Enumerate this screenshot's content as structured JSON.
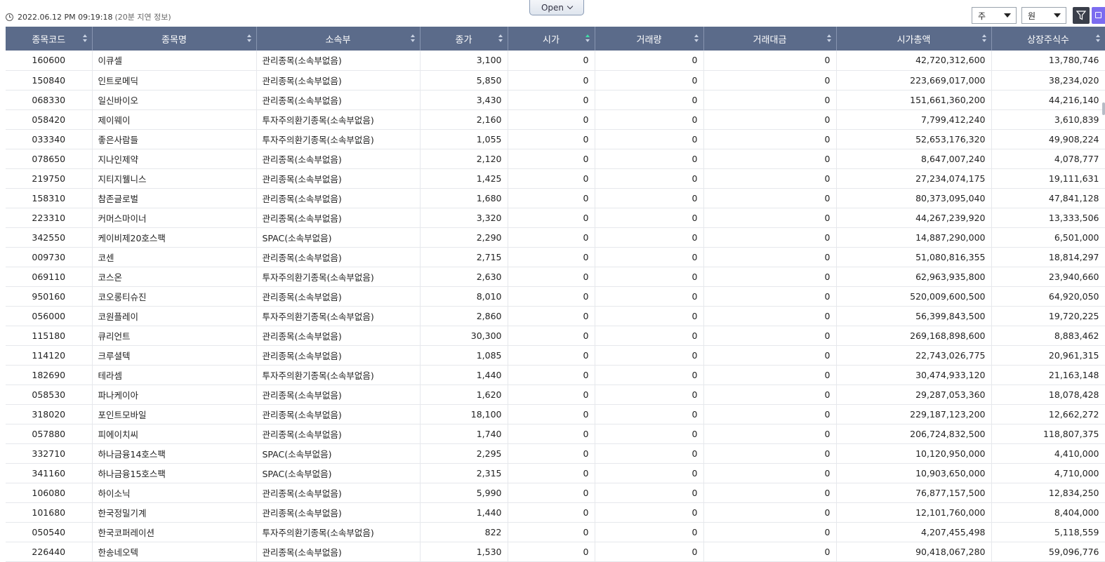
{
  "header": {
    "timestamp": "2022.06.12 PM 09:19:18",
    "delay_note": "(20분 지연 정보)",
    "open_label": "Open",
    "unit_select": "주",
    "currency_select": "원"
  },
  "table": {
    "columns": [
      "종목코드",
      "종목명",
      "소속부",
      "종가",
      "시가",
      "거래량",
      "거래대금",
      "시가총액",
      "상장주식수"
    ],
    "rows": [
      [
        "160600",
        "이큐셀",
        "관리종목(소속부없음)",
        "3,100",
        "0",
        "0",
        "0",
        "42,720,312,600",
        "13,780,746"
      ],
      [
        "150840",
        "인트로메딕",
        "관리종목(소속부없음)",
        "5,850",
        "0",
        "0",
        "0",
        "223,669,017,000",
        "38,234,020"
      ],
      [
        "068330",
        "일신바이오",
        "관리종목(소속부없음)",
        "3,430",
        "0",
        "0",
        "0",
        "151,661,360,200",
        "44,216,140"
      ],
      [
        "058420",
        "제이웨이",
        "투자주의환기종목(소속부없음)",
        "2,160",
        "0",
        "0",
        "0",
        "7,799,412,240",
        "3,610,839"
      ],
      [
        "033340",
        "좋은사람들",
        "투자주의환기종목(소속부없음)",
        "1,055",
        "0",
        "0",
        "0",
        "52,653,176,320",
        "49,908,224"
      ],
      [
        "078650",
        "지나인제약",
        "관리종목(소속부없음)",
        "2,120",
        "0",
        "0",
        "0",
        "8,647,007,240",
        "4,078,777"
      ],
      [
        "219750",
        "지티지웰니스",
        "관리종목(소속부없음)",
        "1,425",
        "0",
        "0",
        "0",
        "27,234,074,175",
        "19,111,631"
      ],
      [
        "158310",
        "참존글로벌",
        "관리종목(소속부없음)",
        "1,680",
        "0",
        "0",
        "0",
        "80,373,095,040",
        "47,841,128"
      ],
      [
        "223310",
        "커머스마이너",
        "관리종목(소속부없음)",
        "3,320",
        "0",
        "0",
        "0",
        "44,267,239,920",
        "13,333,506"
      ],
      [
        "342550",
        "케이비제20호스팩",
        "SPAC(소속부없음)",
        "2,290",
        "0",
        "0",
        "0",
        "14,887,290,000",
        "6,501,000"
      ],
      [
        "009730",
        "코센",
        "관리종목(소속부없음)",
        "2,715",
        "0",
        "0",
        "0",
        "51,080,816,355",
        "18,814,297"
      ],
      [
        "069110",
        "코스온",
        "투자주의환기종목(소속부없음)",
        "2,630",
        "0",
        "0",
        "0",
        "62,963,935,800",
        "23,940,660"
      ],
      [
        "950160",
        "코오롱티슈진",
        "관리종목(소속부없음)",
        "8,010",
        "0",
        "0",
        "0",
        "520,009,600,500",
        "64,920,050"
      ],
      [
        "056000",
        "코원플레이",
        "투자주의환기종목(소속부없음)",
        "2,860",
        "0",
        "0",
        "0",
        "56,399,843,500",
        "19,720,225"
      ],
      [
        "115180",
        "큐리언트",
        "관리종목(소속부없음)",
        "30,300",
        "0",
        "0",
        "0",
        "269,168,898,600",
        "8,883,462"
      ],
      [
        "114120",
        "크루셜텍",
        "관리종목(소속부없음)",
        "1,085",
        "0",
        "0",
        "0",
        "22,743,026,775",
        "20,961,315"
      ],
      [
        "182690",
        "테라셈",
        "투자주의환기종목(소속부없음)",
        "1,440",
        "0",
        "0",
        "0",
        "30,474,933,120",
        "21,163,148"
      ],
      [
        "058530",
        "파나케이아",
        "관리종목(소속부없음)",
        "1,620",
        "0",
        "0",
        "0",
        "29,287,053,360",
        "18,078,428"
      ],
      [
        "318020",
        "포인트모바일",
        "관리종목(소속부없음)",
        "18,100",
        "0",
        "0",
        "0",
        "229,187,123,200",
        "12,662,272"
      ],
      [
        "057880",
        "피에이치씨",
        "관리종목(소속부없음)",
        "1,740",
        "0",
        "0",
        "0",
        "206,724,832,500",
        "118,807,375"
      ],
      [
        "332710",
        "하나금융14호스팩",
        "SPAC(소속부없음)",
        "2,295",
        "0",
        "0",
        "0",
        "10,120,950,000",
        "4,410,000"
      ],
      [
        "341160",
        "하나금융15호스팩",
        "SPAC(소속부없음)",
        "2,315",
        "0",
        "0",
        "0",
        "10,903,650,000",
        "4,710,000"
      ],
      [
        "106080",
        "하이소닉",
        "관리종목(소속부없음)",
        "5,990",
        "0",
        "0",
        "0",
        "76,877,157,500",
        "12,834,250"
      ],
      [
        "101680",
        "한국정밀기계",
        "관리종목(소속부없음)",
        "1,440",
        "0",
        "0",
        "0",
        "12,101,760,000",
        "8,404,000"
      ],
      [
        "050540",
        "한국코퍼레이션",
        "투자주의환기종목(소속부없음)",
        "822",
        "0",
        "0",
        "0",
        "4,207,455,498",
        "5,118,559"
      ],
      [
        "226440",
        "한송네오텍",
        "관리종목(소속부없음)",
        "1,530",
        "0",
        "0",
        "0",
        "90,418,067,280",
        "59,096,776"
      ]
    ]
  }
}
